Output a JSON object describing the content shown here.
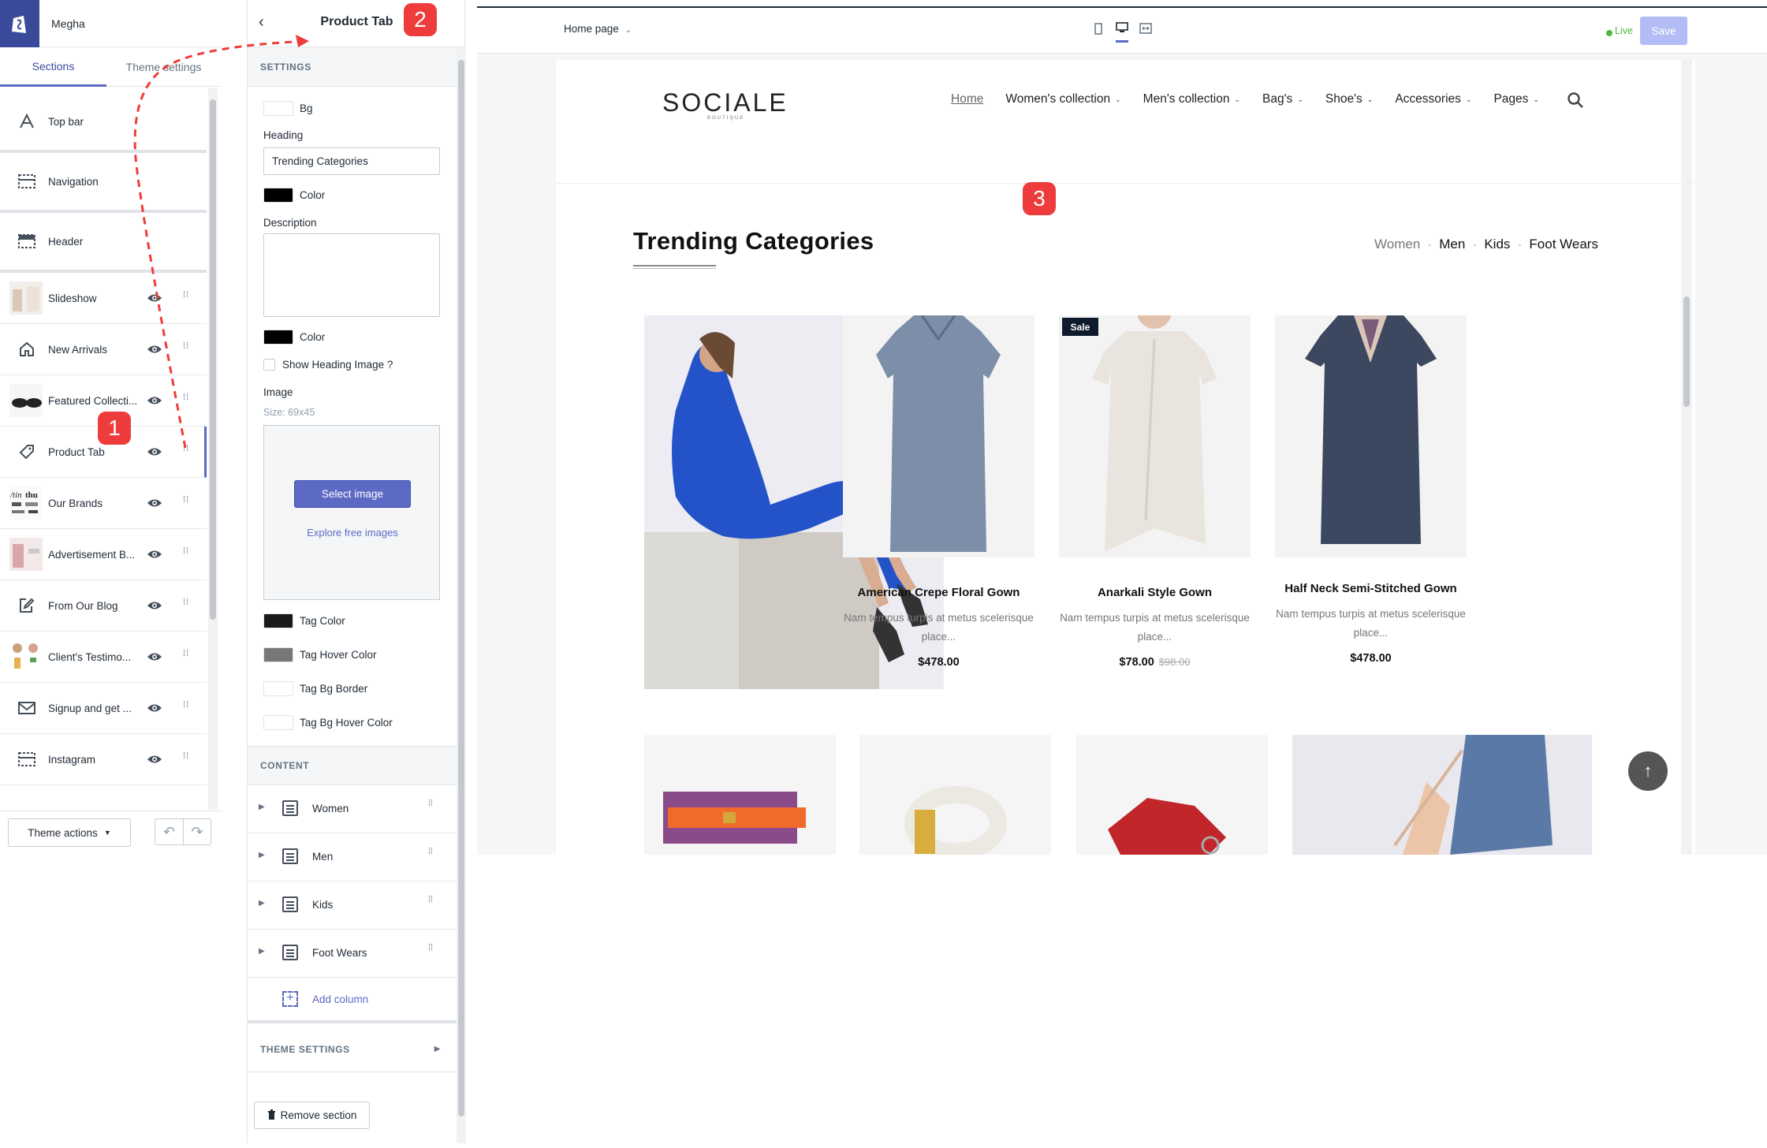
{
  "store": {
    "name": "Megha"
  },
  "left_tabs": {
    "sections": "Sections",
    "theme_settings": "Theme settings"
  },
  "sections": [
    {
      "label": "Top bar",
      "icon": "text-a-icon"
    },
    {
      "label": "Navigation",
      "icon": "navigation-icon"
    },
    {
      "label": "Header",
      "icon": "header-icon"
    },
    {
      "label": "Slideshow",
      "icon": "slideshow-thumb"
    },
    {
      "label": "New Arrivals",
      "icon": "home-icon"
    },
    {
      "label": "Featured Collecti...",
      "icon": "featured-thumb"
    },
    {
      "label": "Product Tab",
      "icon": "tag-icon"
    },
    {
      "label": "Our Brands",
      "icon": "brands-thumb"
    },
    {
      "label": "Advertisement B...",
      "icon": "advertisement-thumb"
    },
    {
      "label": "From Our Blog",
      "icon": "edit-icon"
    },
    {
      "label": "Client's Testimo...",
      "icon": "testimonial-thumb"
    },
    {
      "label": "Signup and get ...",
      "icon": "mail-icon"
    },
    {
      "label": "Instagram",
      "icon": "instagram-icon"
    }
  ],
  "left_footer": {
    "theme_actions": "Theme actions"
  },
  "settings_panel": {
    "title": "Product Tab",
    "settings_header": "SETTINGS",
    "bg_label": "Bg",
    "heading_label": "Heading",
    "heading_value": "Trending Categories",
    "color_label_1": "Color",
    "description_label": "Description",
    "description_value": "",
    "color_label_2": "Color",
    "show_heading_image": "Show Heading Image ?",
    "image_label": "Image",
    "image_size": "Size: 69x45",
    "select_image": "Select image",
    "explore_free_images": "Explore free images",
    "tag_color": "Tag Color",
    "tag_hover_color": "Tag Hover Color",
    "tag_bg_border": "Tag Bg Border",
    "tag_bg_hover_color": "Tag Bg Hover Color",
    "content_header": "CONTENT",
    "blocks": [
      "Women",
      "Men",
      "Kids",
      "Foot Wears"
    ],
    "add_column": "Add column",
    "theme_settings_header": "THEME SETTINGS",
    "remove_section": "Remove section",
    "swatch_colors": {
      "bg": "#ffffff",
      "heading_color": "#000000",
      "desc_color": "#000000",
      "tag_color": "#1a1a1a",
      "tag_hover": "#777777",
      "tag_bg_border": "#ffffff",
      "tag_bg_hover": "#ffffff"
    }
  },
  "preview_bar": {
    "page": "Home page",
    "live": "Live",
    "save": "Save"
  },
  "storefront": {
    "logo": "SOCIALE",
    "logo_sub": "BOUTIQUE",
    "nav": [
      "Home",
      "Women's collection",
      "Men's collection",
      "Bag's",
      "Shoe's",
      "Accessories",
      "Pages"
    ],
    "section_title": "Trending Categories",
    "tabs": [
      "Women",
      "Men",
      "Kids",
      "Foot Wears"
    ],
    "products": [
      {
        "name": "American Crepe Floral Gown",
        "desc": "Nam tempus turpis at metus scelerisque place...",
        "price": "$478.00",
        "old_price": "",
        "sale": ""
      },
      {
        "name": "Anarkali Style Gown",
        "desc": "Nam tempus turpis at metus scelerisque place...",
        "price": "$78.00",
        "old_price": "$98.00",
        "sale": "Sale"
      },
      {
        "name": "Half Neck Semi-Stitched Gown",
        "desc": "Nam tempus turpis at metus scelerisque place...",
        "price": "$478.00",
        "old_price": "",
        "sale": ""
      }
    ]
  },
  "annotations": [
    "1",
    "2",
    "3"
  ],
  "colors": {
    "accent": "#5c6ac4",
    "brand_dark": "#3a4a9b",
    "annotation": "#ee3c3c",
    "live": "#50b83c"
  }
}
